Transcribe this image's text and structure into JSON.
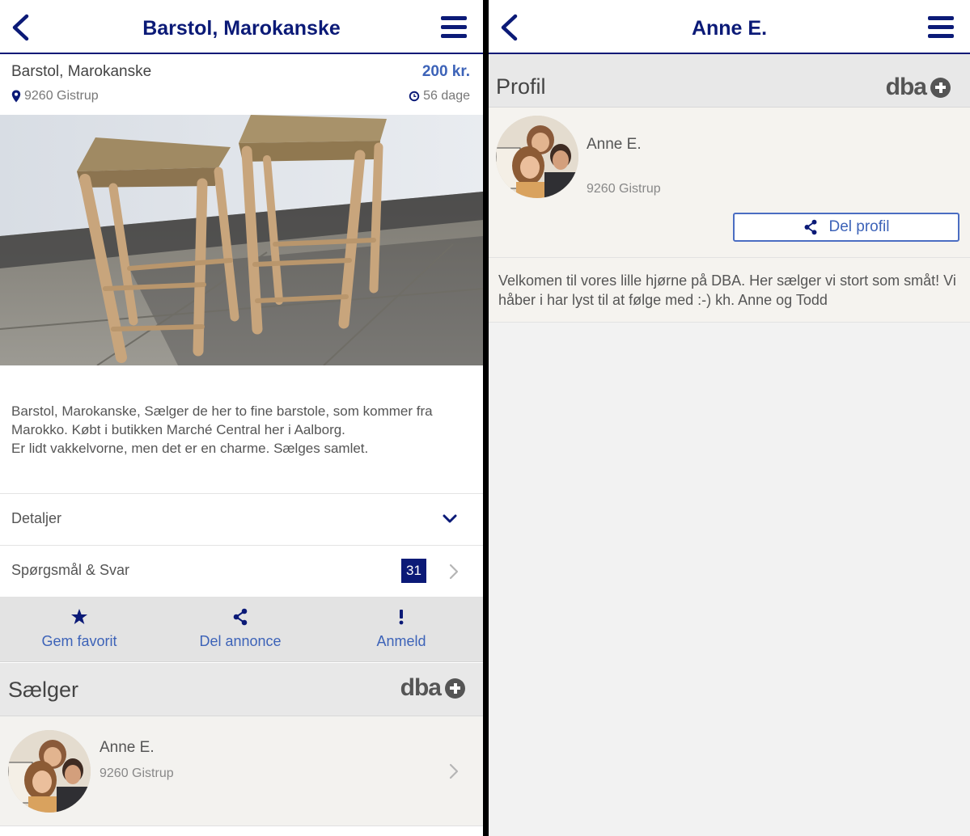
{
  "left": {
    "nav": {
      "title": "Barstol, Marokanske"
    },
    "listing": {
      "title": "Barstol, Marokanske",
      "price": "200 kr.",
      "location": "9260 Gistrup",
      "age": "56 dage",
      "description": [
        "Barstol, Marokanske, Sælger de her to fine barstole, som kommer fra Marokko. Købt i butikken Marché Central her i Aalborg.",
        "Er lidt vakkelvorne, men det er en charme. Sælges samlet."
      ]
    },
    "details_label": "Detaljer",
    "qa": {
      "label": "Spørgsmål & Svar",
      "count": "31"
    },
    "actions": {
      "favorite": "Gem favorit",
      "share": "Del annonce",
      "report": "Anmeld"
    },
    "seller": {
      "section_title": "Sælger",
      "logo": "dba",
      "name": "Anne E.",
      "location": "9260 Gistrup"
    }
  },
  "right": {
    "nav": {
      "title": "Anne E."
    },
    "profile": {
      "section_title": "Profil",
      "logo": "dba",
      "name": "Anne E.",
      "location": "9260 Gistrup",
      "share_label": "Del profil",
      "bio": "Velkomen til vores lille hjørne på DBA. Her sælger vi stort som småt! Vi håber i har lyst til at følge med :-) kh. Anne og Todd"
    }
  },
  "colors": {
    "brand_navy": "#0b1a77",
    "link_blue": "#3d63b8",
    "section_bg": "#e8e8e8"
  },
  "icons": [
    "back-chevron-icon",
    "hamburger-menu-icon",
    "location-pin-icon",
    "clock-icon",
    "chevron-down-icon",
    "chevron-right-icon",
    "star-icon",
    "share-icon",
    "exclamation-icon",
    "dba-plus-icon"
  ]
}
